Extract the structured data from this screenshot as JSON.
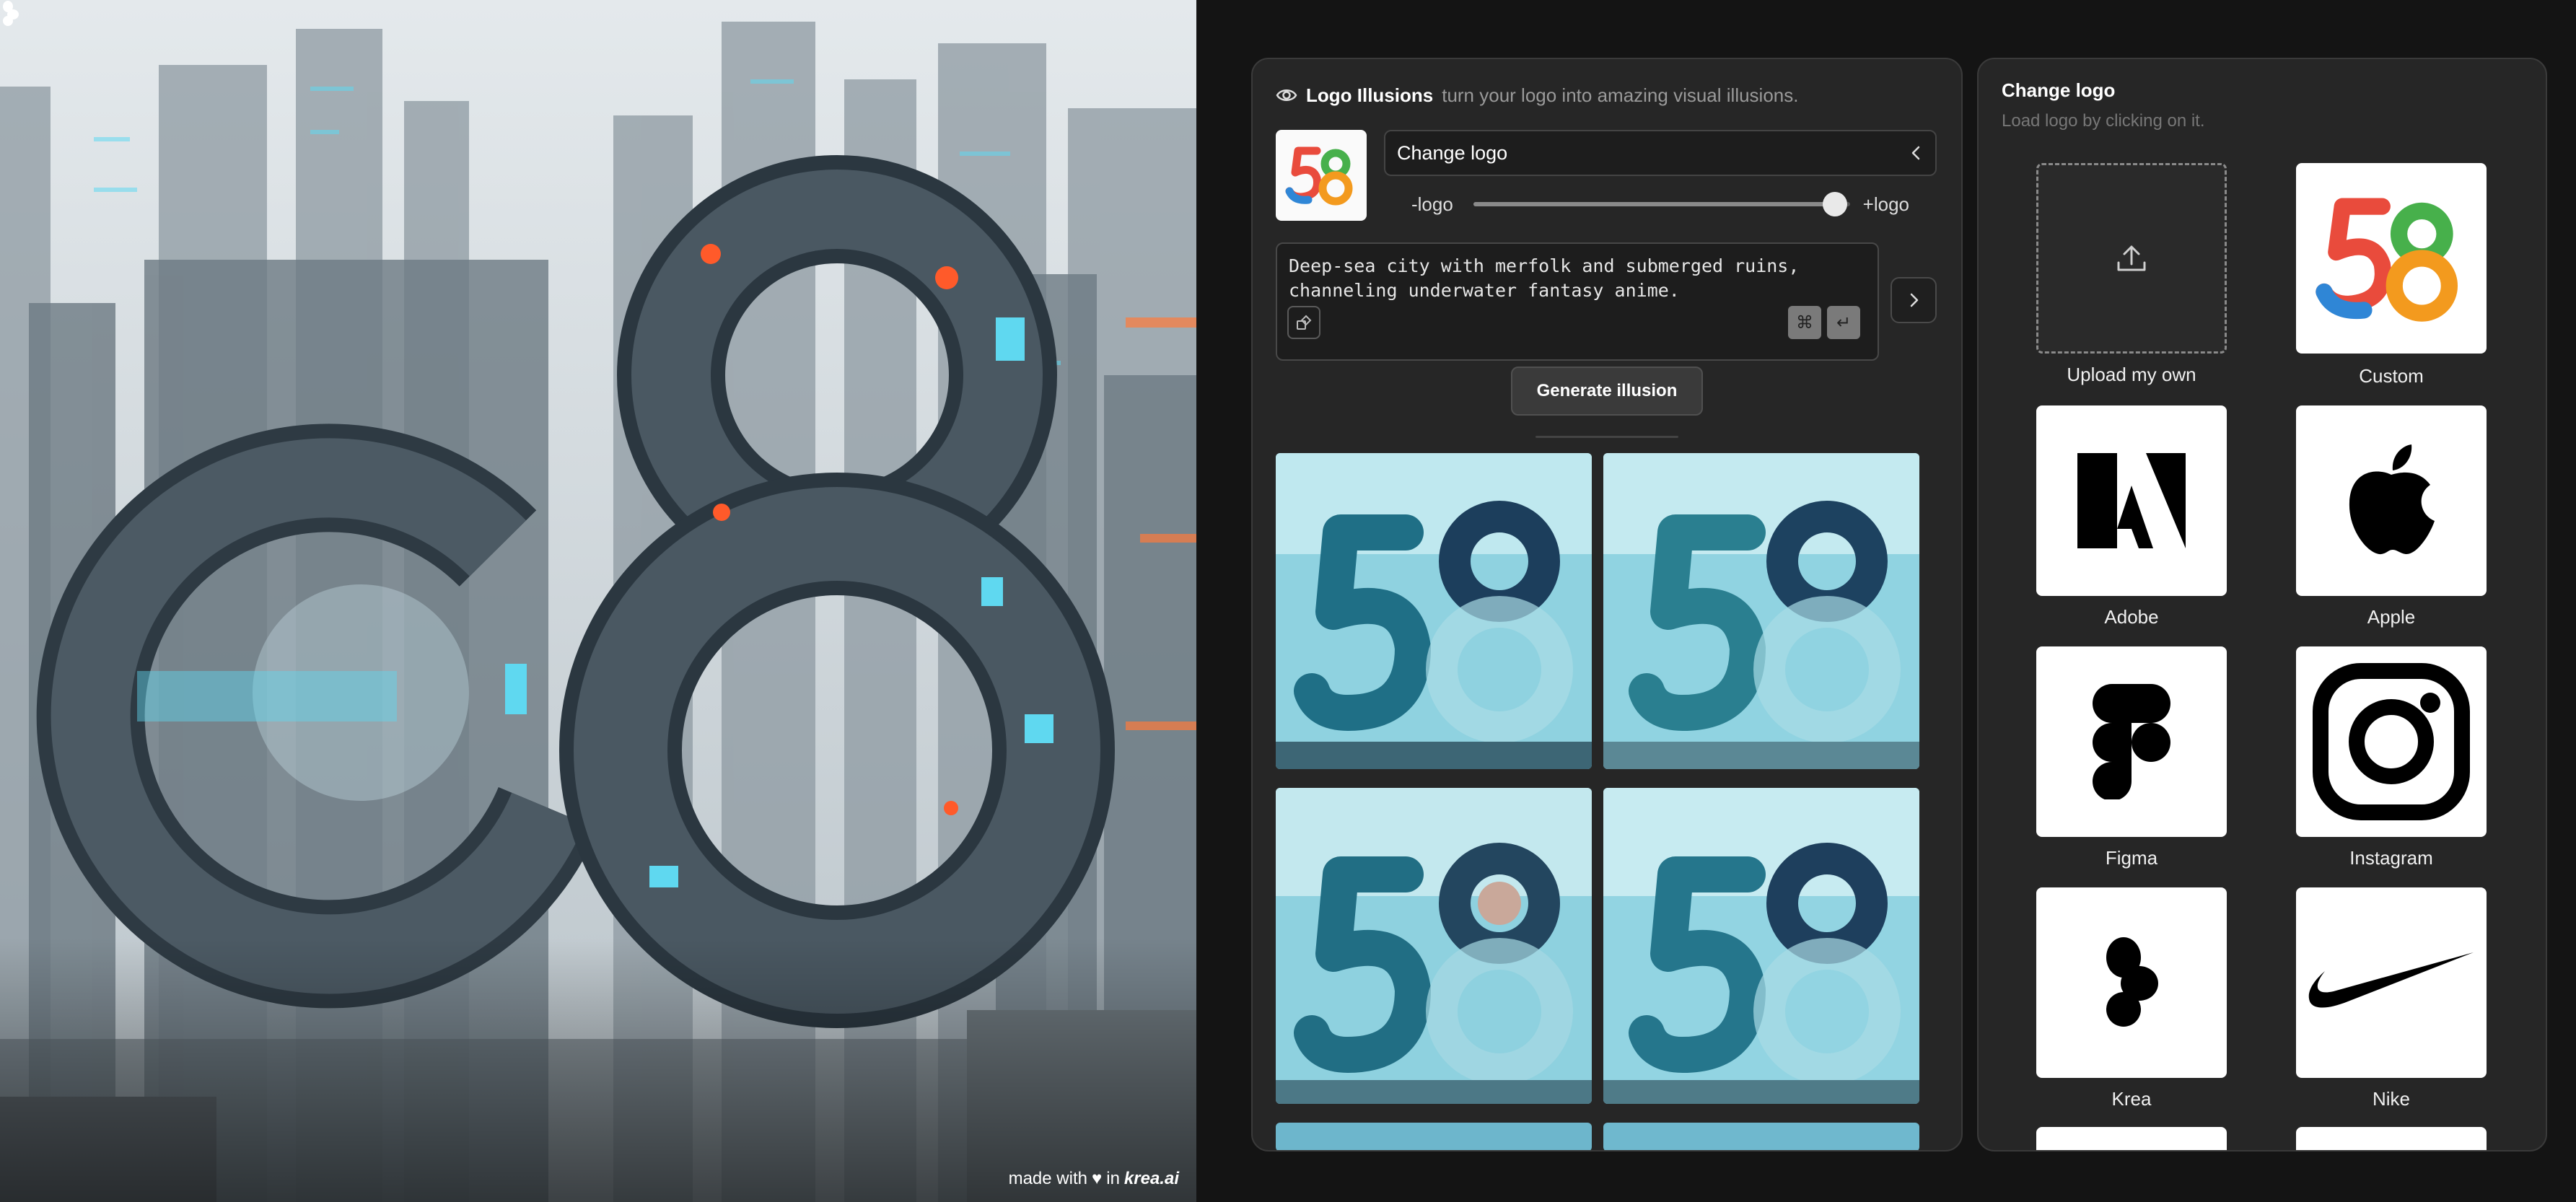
{
  "hero": {
    "caption_prefix": "made with",
    "caption_in": "in",
    "caption_brand": "krea.ai",
    "heart_icon": "heart-icon",
    "krea_icon": "krea-logo-icon"
  },
  "illusion_panel": {
    "title": "Logo Illusions",
    "subtitle": "turn your logo into amazing visual illusions.",
    "change_logo_label": "Change logo",
    "logo_text": "58",
    "slider": {
      "min_label": "-logo",
      "max_label": "+logo",
      "value": 0.96
    },
    "prompt": "Deep-sea city with merfolk and submerged ruins,\nchanneling underwater fantasy anime.",
    "kbd_cmd": "⌘",
    "kbd_enter": "↵",
    "generate_label": "Generate illusion"
  },
  "change_logo_panel": {
    "title": "Change logo",
    "subtitle": "Load logo by clicking on it.",
    "tiles": [
      {
        "label": "Upload my own",
        "icon": "upload-icon"
      },
      {
        "label": "Custom",
        "icon": "custom-58-logo",
        "logo_text": "58"
      },
      {
        "label": "Adobe",
        "icon": "adobe-logo-icon"
      },
      {
        "label": "Apple",
        "icon": "apple-logo-icon"
      },
      {
        "label": "Figma",
        "icon": "figma-logo-icon"
      },
      {
        "label": "Instagram",
        "icon": "instagram-logo-icon"
      },
      {
        "label": "Krea",
        "icon": "krea-logo-icon"
      },
      {
        "label": "Nike",
        "icon": "nike-logo-icon"
      }
    ]
  },
  "colors": {
    "background": "#141414",
    "panel": "#262626",
    "accent_red": "#e94b3c",
    "accent_blue": "#2f86d6",
    "accent_green": "#47b04b",
    "accent_orange": "#f39a1e"
  }
}
